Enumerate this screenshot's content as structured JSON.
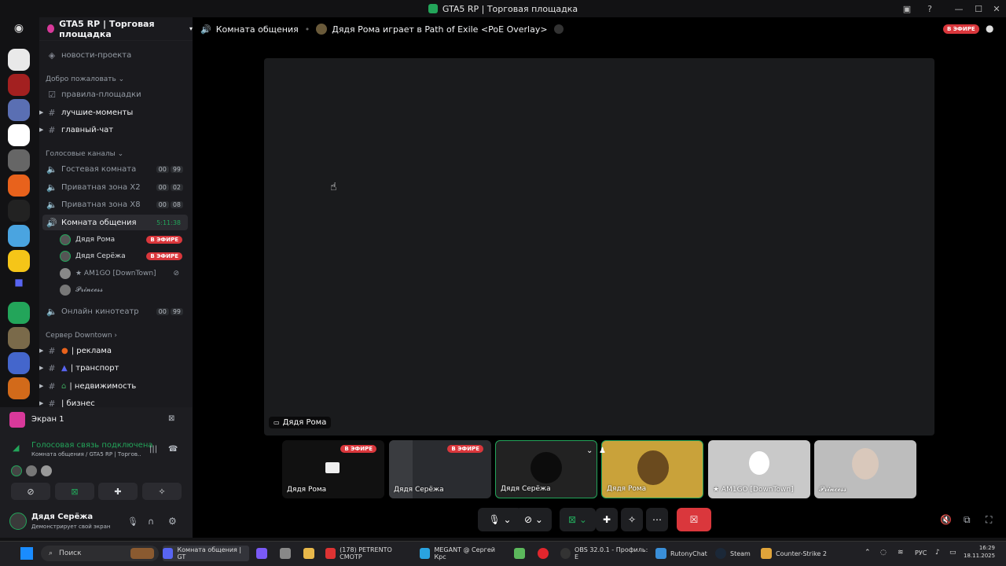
{
  "window": {
    "title": "GTA5 RP | Торговая площадка"
  },
  "server": {
    "name": "GTA5 RP | Торговая площадка"
  },
  "channels": {
    "top_item": "новости-проекта",
    "cat_welcome": "Добро пожаловать",
    "rules": "правила-площадки",
    "best": "лучшие-моменты",
    "main_chat": "главный-чат",
    "cat_voice": "Голосовые каналы",
    "guest_room": "Гостевая комната",
    "guest_count": "00",
    "guest_max": "99",
    "private_x2": "Приватная зона X2",
    "x2_count": "00",
    "x2_max": "02",
    "private_x8": "Приватная зона X8",
    "x8_count": "00",
    "x8_max": "08",
    "comm_room": "Комната общения",
    "comm_time": "5:11:38",
    "cinema": "Онлайн кинотеатр",
    "cinema_count": "00",
    "cinema_max": "99",
    "cat_downtown": "Сервер Downtown",
    "ads": "| реклама",
    "transport": "| транспорт",
    "realty": "| недвижимость",
    "business": "| бизнес"
  },
  "voice_users": [
    {
      "name": "Дядя Рома",
      "live": "В ЭФИРЕ"
    },
    {
      "name": "Дядя Серёжа",
      "live": "В ЭФИРЕ"
    },
    {
      "name": "★ AM1GO [DownTown]"
    },
    {
      "name": "𝓟𝓻𝓲𝓷𝓬𝓮𝓼𝓼"
    }
  ],
  "panel": {
    "screen": "Экран 1",
    "connected": "Голосовая связь подключена",
    "location": "Комната общения / GTA5 RP | Торгов...",
    "username": "Дядя Серёжа",
    "status": "Демонстрирует свой экран"
  },
  "topbar": {
    "channel": "Комната общения",
    "activity": "Дядя Рома играет в Path of Exile <PoE Overlay>",
    "live": "В ЭФИРЕ"
  },
  "stage": {
    "main_name": "Дядя Рома"
  },
  "tiles": [
    {
      "name": "Дядя Рома",
      "live": "В ЭФИРЕ"
    },
    {
      "name": "Дядя Серёжа",
      "live": "В ЭФИРЕ"
    },
    {
      "name": "Дядя Серёжа"
    },
    {
      "name": "Дядя Рома"
    },
    {
      "name": "★ AM1GO [DownTown]"
    },
    {
      "name": "𝓟𝓻𝓲𝓷𝓬𝓮𝓼𝓼"
    }
  ],
  "taskbar": {
    "search": "Поиск",
    "apps": [
      "Комната общения | GT",
      "(178) PETRENTO СМОТР",
      "MEGANT @ Сергей Крс",
      "OBS 32.0.1 - Профиль: Е",
      "RutonyChat",
      "Steam",
      "Counter-Strike 2"
    ],
    "lang": "РУС",
    "time": "16:29",
    "date": "18.11.2025"
  },
  "colors": {
    "accent_green": "#23a55a",
    "live_red": "#da373c",
    "leave_red": "#da373c"
  }
}
